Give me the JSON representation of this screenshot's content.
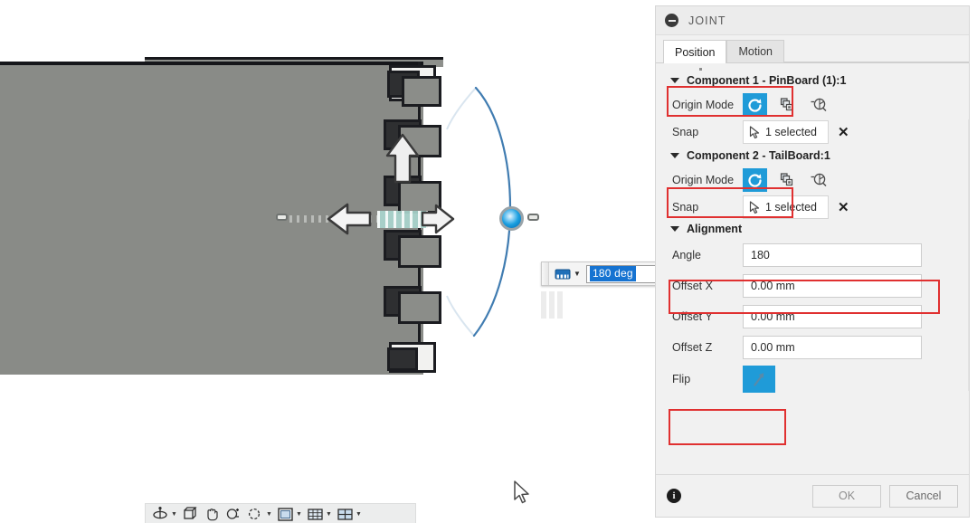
{
  "panel": {
    "title": "JOINT",
    "collapse_icon": "minus-circle-icon",
    "tabs": [
      {
        "label": "Position",
        "active": true
      },
      {
        "label": "Motion",
        "active": false
      }
    ],
    "components": [
      {
        "heading": "Component 1 - PinBoard (1):1",
        "origin_mode": {
          "label": "Origin Mode",
          "options": [
            {
              "icon": "auto-origin-icon",
              "active": true
            },
            {
              "icon": "between-two-faces-icon",
              "active": false
            },
            {
              "icon": "two-edge-intersection-icon",
              "active": false
            }
          ]
        },
        "snap": {
          "label": "Snap",
          "icon": "cursor-select-icon",
          "value": "1 selected",
          "clear_label": "✕"
        }
      },
      {
        "heading": "Component 2 - TailBoard:1",
        "origin_mode": {
          "label": "Origin Mode",
          "options": [
            {
              "icon": "auto-origin-icon",
              "active": true
            },
            {
              "icon": "between-two-faces-icon",
              "active": false
            },
            {
              "icon": "two-edge-intersection-icon",
              "active": false
            }
          ]
        },
        "snap": {
          "label": "Snap",
          "icon": "cursor-select-icon",
          "value": "1 selected",
          "clear_label": "✕"
        }
      }
    ],
    "alignment": {
      "heading": "Alignment",
      "fields": [
        {
          "label": "Angle",
          "value": "180"
        },
        {
          "label": "Offset X",
          "value": "0.00 mm"
        },
        {
          "label": "Offset Y",
          "value": "0.00 mm"
        },
        {
          "label": "Offset Z",
          "value": "0.00 mm"
        }
      ],
      "flip": {
        "label": "Flip",
        "icon": "flip-arrow-icon",
        "active": true
      }
    },
    "footer": {
      "info_icon": "info-icon",
      "info_glyph": "i",
      "ok_label": "OK",
      "cancel_label": "Cancel"
    }
  },
  "float_input": {
    "unit_icon": "angle-unit-icon",
    "caret_icon": "chevron-down-icon",
    "value": "180 deg"
  },
  "navbar": {
    "items": [
      {
        "icon": "orbit-icon",
        "has_caret": true
      },
      {
        "icon": "look-at-icon",
        "has_caret": false
      },
      {
        "icon": "pan-hand-icon",
        "has_caret": false
      },
      {
        "icon": "zoom-icon",
        "has_caret": false
      },
      {
        "icon": "zoom-window-icon",
        "has_caret": true
      },
      {
        "icon": "display-settings-icon",
        "has_caret": true
      },
      {
        "icon": "grid-snap-icon",
        "has_caret": true
      },
      {
        "icon": "viewports-icon",
        "has_caret": true
      }
    ]
  },
  "viewport": {
    "cursor_icon": "mouse-pointer-icon",
    "joint_origin_icon": "joint-origin-marker",
    "arc_icon": "rotation-arc",
    "manipulators": [
      {
        "icon": "arrow-up-manipulator"
      },
      {
        "icon": "arrow-right-manipulator"
      },
      {
        "icon": "arrow-left-manipulator"
      }
    ]
  },
  "colors": {
    "accent_blue": "#1f9bd8",
    "highlight_red": "#e03030",
    "board_gray": "#898b87",
    "selected_face_teal": "#a9d5cd",
    "arc_blue": "#2b6ea8",
    "selection_blue": "#1673d1"
  }
}
